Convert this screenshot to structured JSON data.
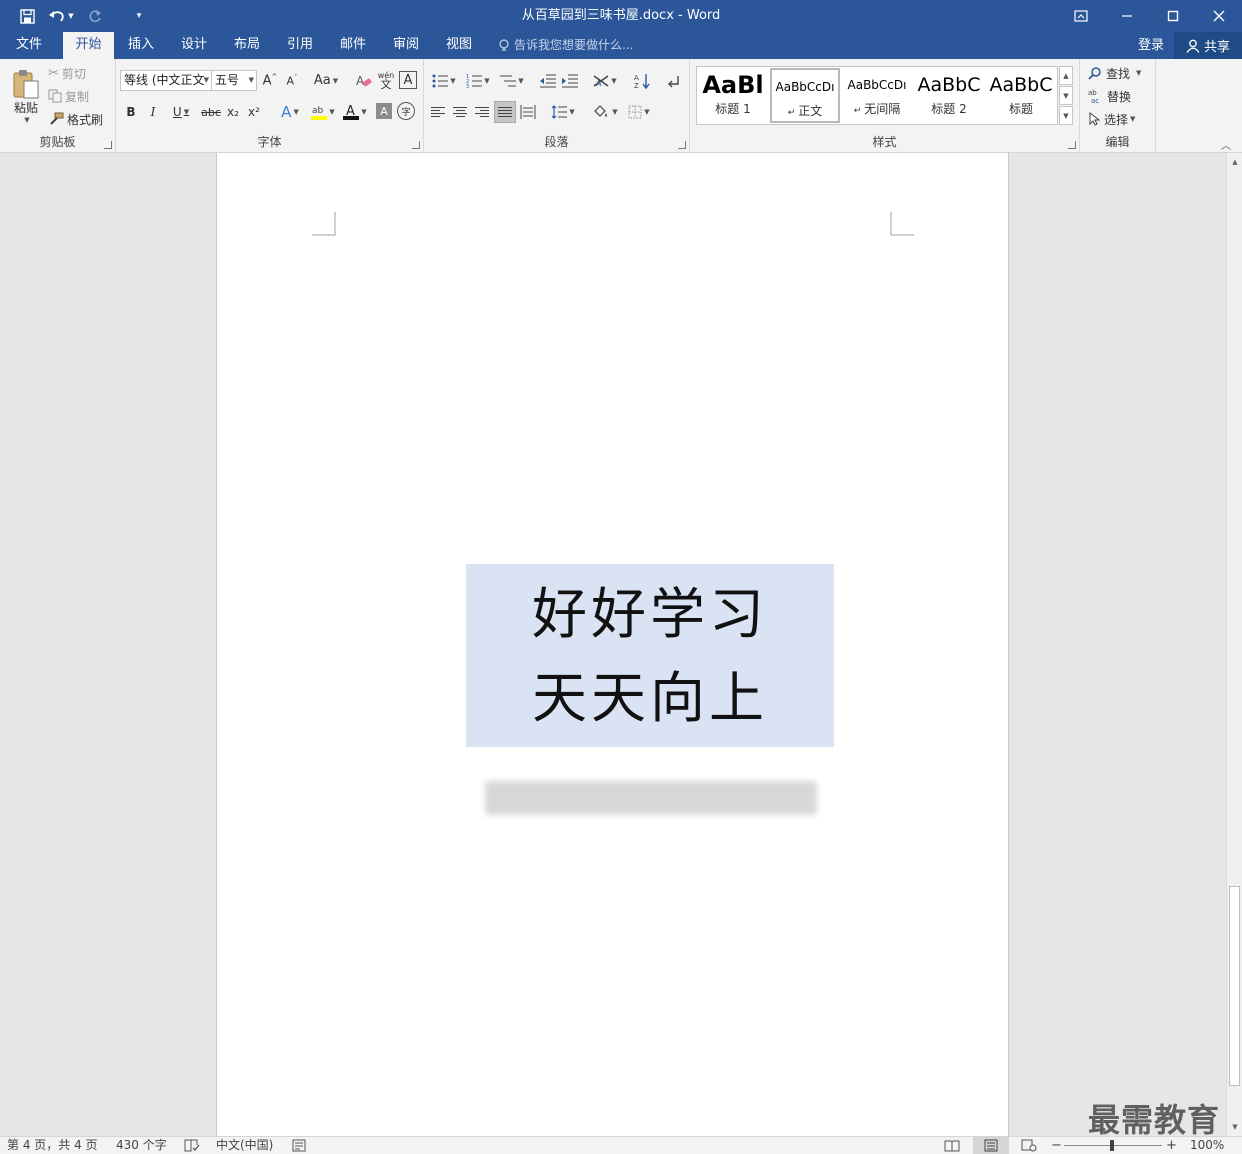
{
  "titlebar": {
    "title": "从百草园到三味书屋.docx - Word",
    "save_icon": "save-icon",
    "undo_icon": "undo-icon",
    "redo_icon": "redo-icon",
    "customize_icon": "customize-qat-icon"
  },
  "tabs": [
    "文件",
    "开始",
    "插入",
    "设计",
    "布局",
    "引用",
    "邮件",
    "审阅",
    "视图"
  ],
  "active_tab": "开始",
  "tell_me": "告诉我您想要做什么...",
  "account": {
    "login": "登录",
    "share": "共享"
  },
  "clipboard": {
    "label": "剪贴板",
    "paste": "粘贴",
    "cut": "剪切",
    "copy": "复制",
    "format_painter": "格式刷"
  },
  "font": {
    "label": "字体",
    "font_name": "等线 (中文正文",
    "font_size": "五号",
    "aa": "Aa",
    "bold": "B",
    "italic": "I",
    "underline": "U",
    "strike": "abc",
    "subscript": "x₂",
    "superscript": "x²",
    "wen": "wén",
    "wen_sub": "文",
    "border_char": "A",
    "shade_char": "A",
    "enclose_char": "字"
  },
  "paragraph": {
    "label": "段落"
  },
  "styles": {
    "label": "样式",
    "items": [
      {
        "sample": "AaBl",
        "name": "标题 1"
      },
      {
        "sample": "AaBbCcDı",
        "name": "正文"
      },
      {
        "sample": "AaBbCcDı",
        "name": "无间隔"
      },
      {
        "sample": "AaBbC",
        "name": "标题 2"
      },
      {
        "sample": "AaBbC",
        "name": "标题"
      }
    ]
  },
  "editing": {
    "label": "编辑",
    "find": "查找",
    "replace": "替换",
    "select": "选择"
  },
  "document": {
    "line1": "好好学习",
    "line2": "天天向上"
  },
  "status": {
    "page": "第 4 页，共 4 页",
    "words": "430 个字",
    "language": "中文(中国)",
    "zoom": "100%"
  },
  "watermark": "最需教育",
  "colors": {
    "brand": "#2b579a",
    "textbox_fill": "#dae3f3",
    "highlight": "#ffff00",
    "font_color": "#c00000"
  }
}
